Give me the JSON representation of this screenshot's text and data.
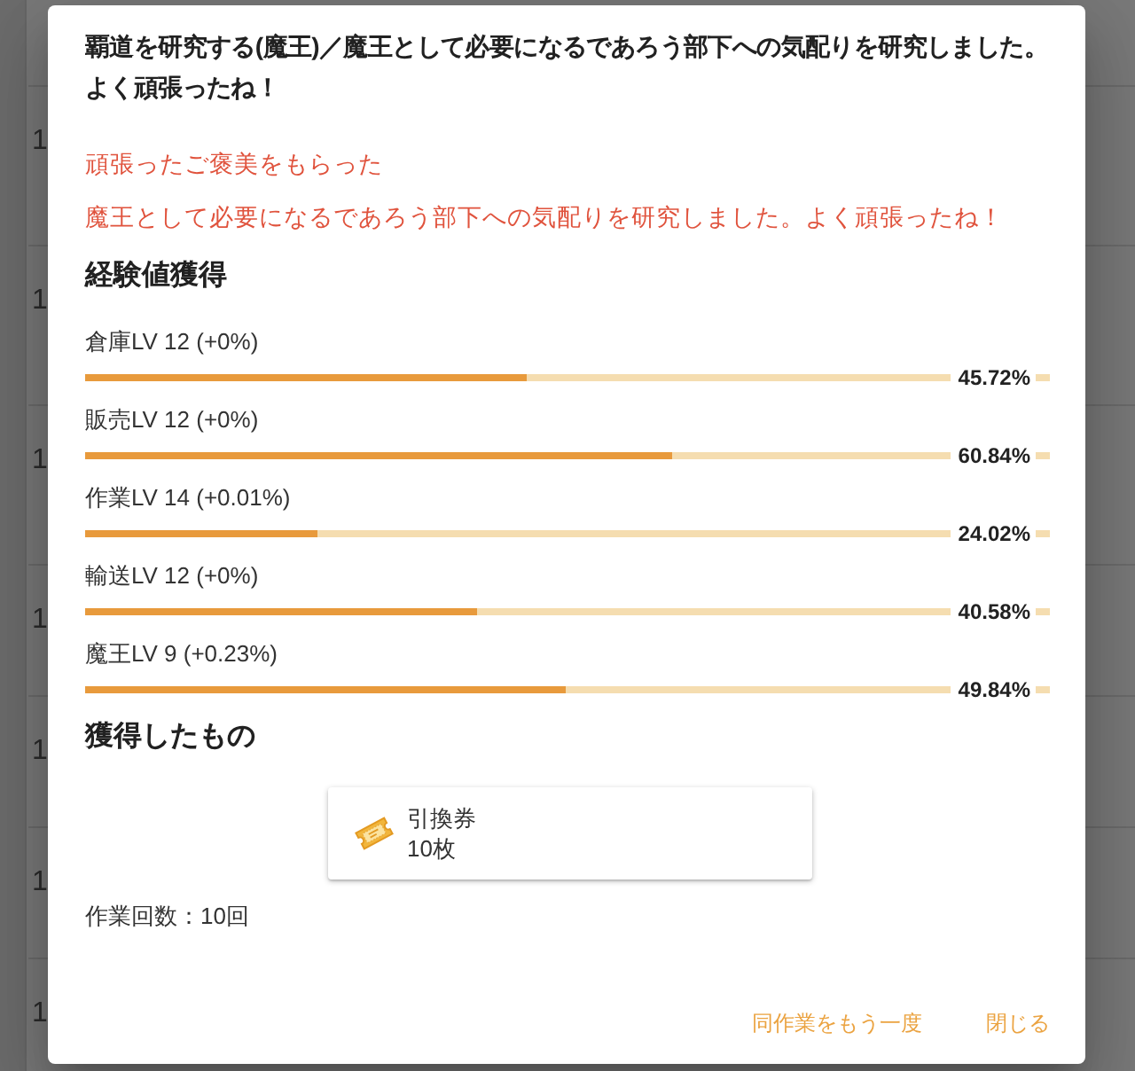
{
  "background": {
    "rows": [
      {
        "number": "1"
      },
      {
        "number": "1"
      },
      {
        "number": "1"
      },
      {
        "number": "1"
      },
      {
        "number": "1"
      },
      {
        "number": "1"
      },
      {
        "number": "1"
      }
    ]
  },
  "dialog": {
    "title": "覇道を研究する(魔王)／魔王として必要になるであろう部下への気配りを研究しました。よく頑張ったね！",
    "messages": [
      "頑張ったご褒美をもらった",
      "魔王として必要になるであろう部下への気配りを研究しました。よく頑張ったね！"
    ],
    "experience": {
      "heading": "経験値獲得",
      "skills": [
        {
          "label": "倉庫LV 12 (+0%)",
          "level": 0.4572,
          "reading": "45.72%"
        },
        {
          "label": "販売LV 12 (+0%)",
          "level": 0.6084,
          "reading": "60.84%"
        },
        {
          "label": "作業LV 14 (+0.01%)",
          "level": 0.2402,
          "reading": "24.02%"
        },
        {
          "label": "輸送LV 12 (+0%)",
          "level": 0.4058,
          "reading": "40.58%"
        },
        {
          "label": "魔王LV 9 (+0.23%)",
          "level": 0.4984,
          "reading": "49.84%"
        }
      ]
    },
    "rewards": {
      "heading": "獲得したもの",
      "items": [
        {
          "name": "引換券",
          "quantity": "10枚"
        }
      ]
    },
    "work_count": "作業回数：10回",
    "buttons": [
      {
        "label": "同作業をもう一度"
      },
      {
        "label": "閉じる"
      }
    ]
  }
}
